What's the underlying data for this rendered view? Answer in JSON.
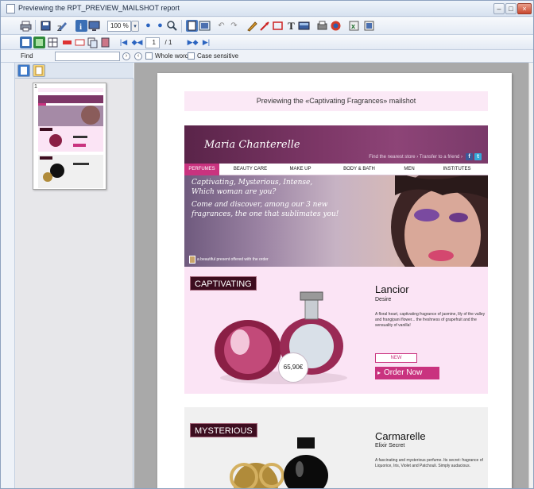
{
  "window": {
    "title": "Previewing the RPT_PREVIEW_MAILSHOT report"
  },
  "toolbar": {
    "zoom_value": "100 %",
    "page_value": "1",
    "page_total": "/ 1"
  },
  "findbar": {
    "find_label": "Find",
    "find_value": "",
    "whole_word_label": "Whole word",
    "case_sensitive_label": "Case sensitive"
  },
  "thumbnails": {
    "page_number": "1"
  },
  "report": {
    "preview_heading": "Previewing the «Captivating Fragrances» mailshot",
    "logo": "Maria Chanterelle",
    "header_links": "Find the nearest store ›   Transfer to a friend ›",
    "nav": [
      "PERFUMES",
      "BEAUTY CARE",
      "MAKE UP",
      "BODY & BATH",
      "MEN",
      "INSTITUTES"
    ],
    "hero": {
      "line1": "Captivating, Mysterious, Intense,",
      "line2": "Which woman are you?",
      "line3": "Come and discover, among our 3 new",
      "line4": "fragrances, the one that sublimates you!",
      "footnote": "a beautiful present offered with the order"
    },
    "products": [
      {
        "tag": "CAPTIVATING",
        "name": "Lancior",
        "subtitle": "Desire",
        "description": "A floral heart, captivating fragrance of jasmine, lily of the valley and frangipani flower... the freshness of grapefruit and the sensuality of vanilla!",
        "price": "65,90€",
        "new_label": "NEW",
        "order_label": "Order Now"
      },
      {
        "tag": "MYSTERIOUS",
        "name": "Carmarelle",
        "subtitle": "Elixir Secret",
        "description": "A fascinating and mysterious perfume. Its secret: fragrance of Liquorice, Iris, Violet and Patchouli. Simply audacious."
      }
    ]
  },
  "colors": {
    "accent": "#c9337f",
    "header": "#7d3767",
    "tag_bg": "#3d0d1f",
    "block_pink": "#fbe4f5"
  }
}
